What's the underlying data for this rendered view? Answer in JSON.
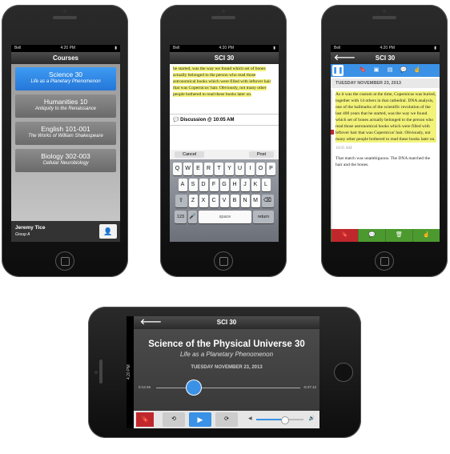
{
  "phone1": {
    "status": {
      "carrier": "Bell",
      "time": "4:20 PM"
    },
    "title": "Courses",
    "courses": [
      {
        "title": "Science 30",
        "subtitle": "Life as a Planetary Phenomenon"
      },
      {
        "title": "Humanities 10",
        "subtitle": "Antiquity to the Renaissance"
      },
      {
        "title": "English 101-001",
        "subtitle": "The Works of William Shakespeare"
      },
      {
        "title": "Biology 302-003",
        "subtitle": "Cellular Neurobiology"
      }
    ],
    "user": {
      "name": "Jeremy Tice",
      "group": "Group A"
    }
  },
  "phone2": {
    "status": {
      "carrier": "Bell",
      "time": "4:20 PM"
    },
    "title": "SCI 30",
    "text": "he started, was the way we found which set of bones actually belonged to the person who read those astronomical books which were filled with leftover hair that was Copernicus' hair. Obviously, not many other people bothered to read these books later on.",
    "discussion": "Discussion @ 10:05 AM",
    "cancel": "Cancel",
    "post": "Post",
    "keys_row1": [
      "Q",
      "W",
      "E",
      "R",
      "T",
      "Y",
      "U",
      "I",
      "O",
      "P"
    ],
    "keys_row2": [
      "A",
      "S",
      "D",
      "F",
      "G",
      "H",
      "J",
      "K",
      "L"
    ],
    "keys_row3": [
      "Z",
      "X",
      "C",
      "V",
      "B",
      "N",
      "M"
    ],
    "key_123": "123",
    "key_space": "space",
    "key_return": "return"
  },
  "phone3": {
    "status": {
      "carrier": "Bell",
      "time": "4:20 PM"
    },
    "title": "SCI 30",
    "date": "TUESDAY NOVEMBER 23, 2013",
    "text": "As it was the custom at the time, Copernicus was buried, together with 14 others in that cathedral. DNA analysis, one of the hallmarks of the scientific revolution of the last 400 years that he started, was the way we found which set of bones actually belonged to the person who read those astronomical books which were filled with leftover hair that was Copernicus' hair. Obviously, not many other people bothered to read these books later on.",
    "time": "10:05 AM",
    "text2": "That match was unambiguous. The DNA matched the hair and the bones."
  },
  "phone4": {
    "title": "SCI 30",
    "course": "Science of the Physical Universe 30",
    "subtitle": "Life as a Planetary Phenomenon",
    "date": "TUESDAY NOVEMBER 23, 2013",
    "elapsed": "0:12:46",
    "remaining": "-0:47:12",
    "status_time": "4:20 PM",
    "progress": 0.26,
    "volume": 0.6
  }
}
